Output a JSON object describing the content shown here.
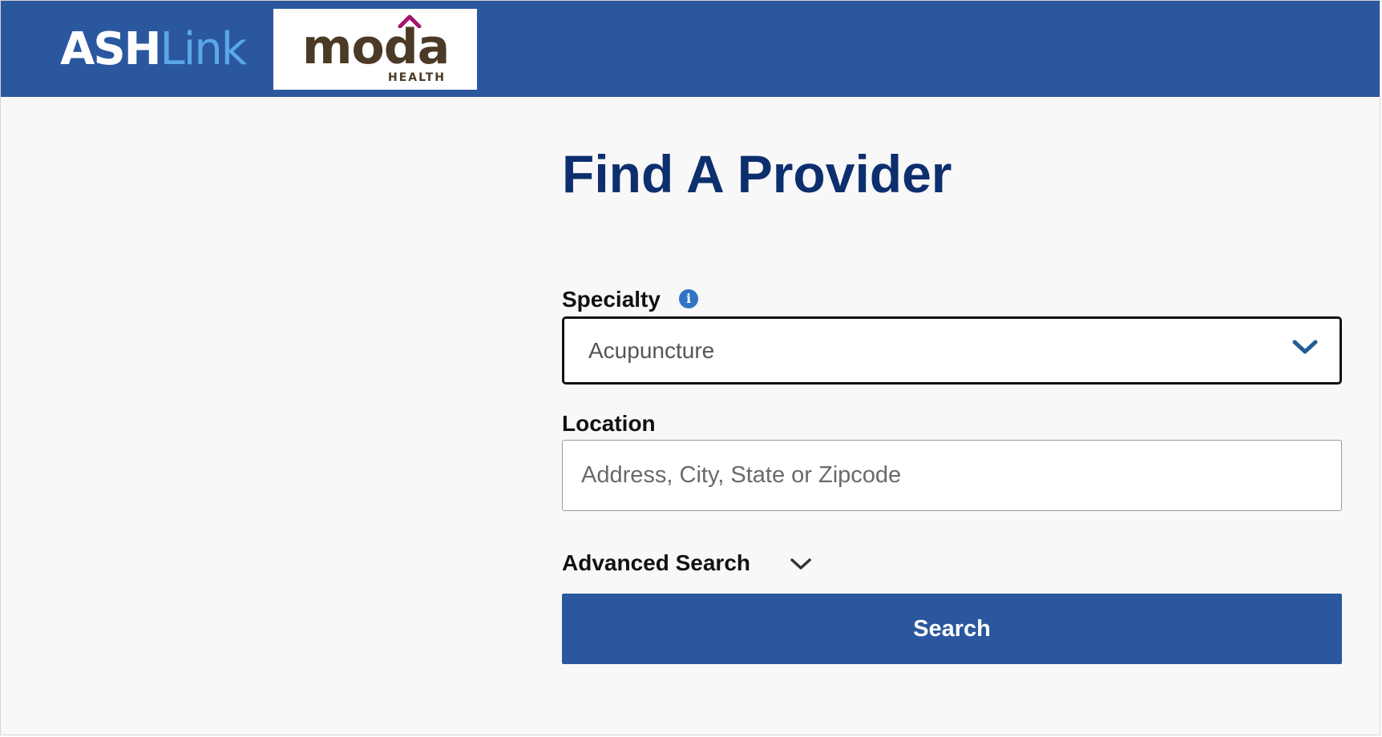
{
  "header": {
    "logo_ash": "ASH",
    "logo_link": "Link",
    "partner_logo": "moda",
    "partner_logo_sub": "HEALTH",
    "colors": {
      "bar": "#2b579e",
      "ash": "#ffffff",
      "link": "#5aa7e8",
      "moda": "#4b3a26",
      "moda_roof": "#a3166f"
    }
  },
  "main": {
    "title": "Find A Provider",
    "specialty": {
      "label": "Specialty",
      "info_icon": "info-icon",
      "info_glyph": "i",
      "selected": "Acupuncture",
      "chevron_icon": "chevron-down-icon"
    },
    "location": {
      "label": "Location",
      "value": "",
      "placeholder": "Address, City, State or Zipcode"
    },
    "advanced_search": {
      "label": "Advanced Search",
      "chevron_icon": "chevron-down-icon"
    },
    "search_button": "Search"
  },
  "colors": {
    "title": "#0d2f6e",
    "button": "#2b579e",
    "info": "#2f74c4",
    "select_chevron": "#1f5f96"
  }
}
